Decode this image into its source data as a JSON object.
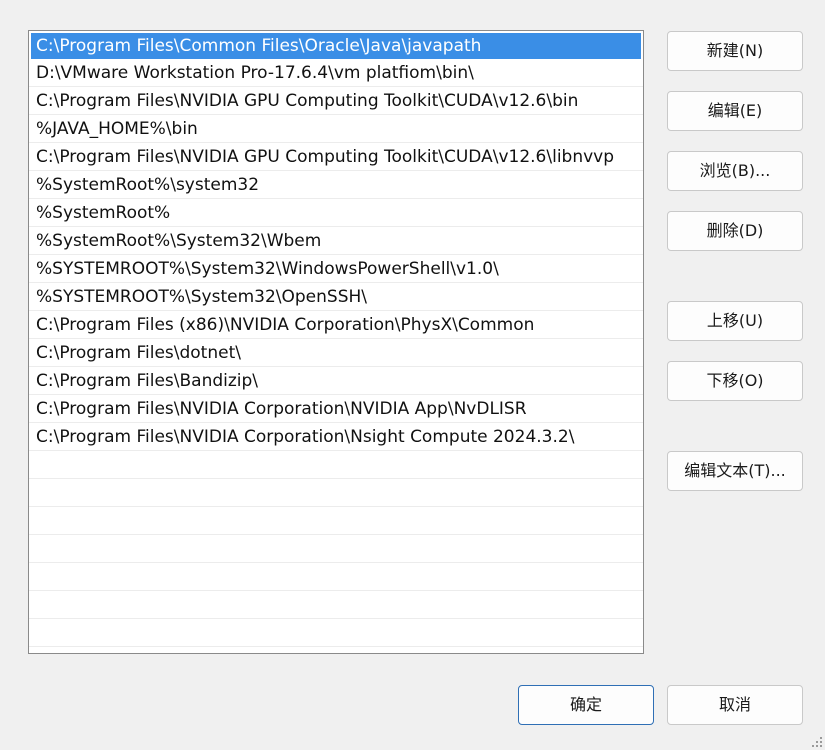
{
  "path_entries": [
    "C:\\Program Files\\Common Files\\Oracle\\Java\\javapath",
    "D:\\VMware Workstation Pro-17.6.4\\vm platfiom\\bin\\",
    "C:\\Program Files\\NVIDIA GPU Computing Toolkit\\CUDA\\v12.6\\bin",
    "%JAVA_HOME%\\bin",
    "C:\\Program Files\\NVIDIA GPU Computing Toolkit\\CUDA\\v12.6\\libnvvp",
    "%SystemRoot%\\system32",
    "%SystemRoot%",
    "%SystemRoot%\\System32\\Wbem",
    "%SYSTEMROOT%\\System32\\WindowsPowerShell\\v1.0\\",
    "%SYSTEMROOT%\\System32\\OpenSSH\\",
    "C:\\Program Files (x86)\\NVIDIA Corporation\\PhysX\\Common",
    "C:\\Program Files\\dotnet\\",
    "C:\\Program Files\\Bandizip\\",
    "C:\\Program Files\\NVIDIA Corporation\\NVIDIA App\\NvDLISR",
    "C:\\Program Files\\NVIDIA Corporation\\Nsight Compute 2024.3.2\\"
  ],
  "empty_row_count": 7,
  "selected_index": 0,
  "buttons": {
    "new": "新建(N)",
    "edit": "编辑(E)",
    "browse": "浏览(B)...",
    "delete": "删除(D)",
    "move_up": "上移(U)",
    "move_down": "下移(O)",
    "edit_text": "编辑文本(T)...",
    "ok": "确定",
    "cancel": "取消"
  },
  "colors": {
    "selection": "#3a8ee6",
    "dialog_background": "#f0f0f0",
    "primary_border": "#2f6fb5"
  }
}
